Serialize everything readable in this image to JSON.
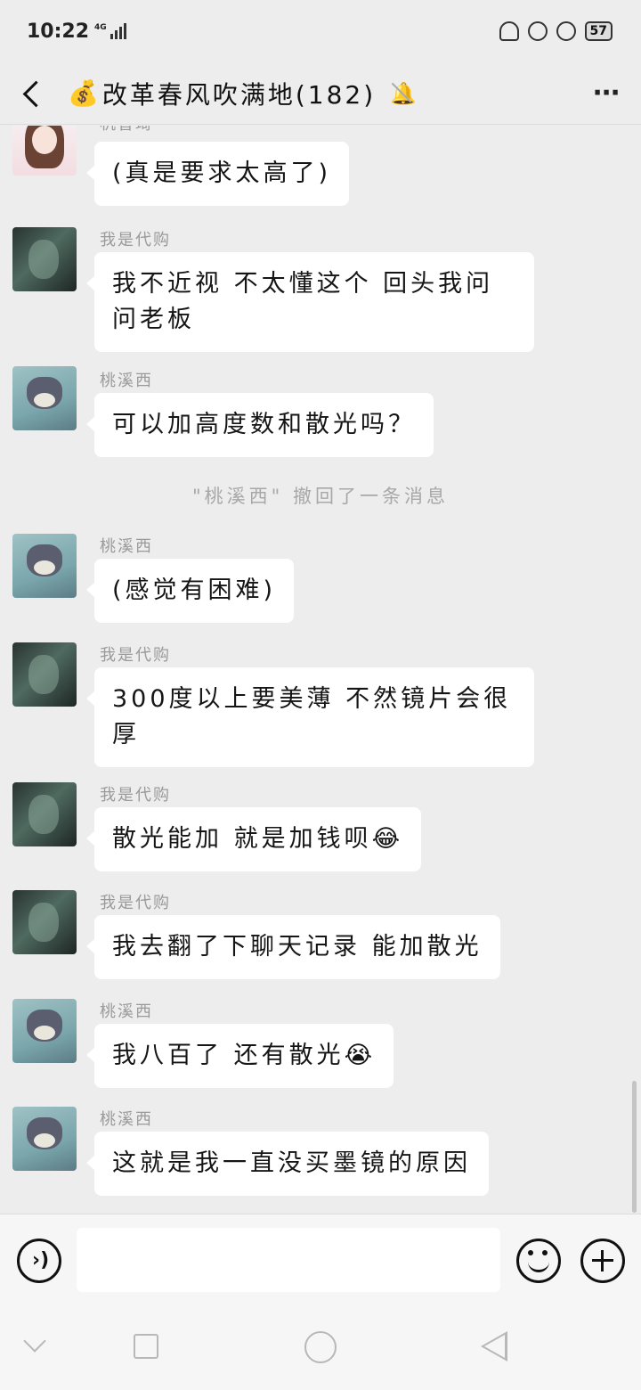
{
  "status_bar": {
    "time": "10:22",
    "network": "4G",
    "battery": "57"
  },
  "title_bar": {
    "emoji": "💰",
    "title": "改革春风吹满地(182)"
  },
  "messages": [
    {
      "sender": "机智琦",
      "text": "(真是要求太高了)",
      "avatar": "girl-avatar"
    },
    {
      "sender": "我是代购",
      "text": "我不近视 不太懂这个 回头我问问老板",
      "avatar": "dark-avatar"
    },
    {
      "sender": "桃溪西",
      "text": "可以加高度数和散光吗？",
      "avatar": "cat-avatar"
    },
    {
      "sender": "桃溪西",
      "text": "(感觉有困难)",
      "avatar": "cat-avatar"
    },
    {
      "sender": "我是代购",
      "text": "300度以上要美薄 不然镜片会很厚",
      "avatar": "dark-avatar"
    },
    {
      "sender": "我是代购",
      "text": "散光能加 就是加钱呗😂",
      "avatar": "dark-avatar"
    },
    {
      "sender": "我是代购",
      "text": "我去翻了下聊天记录 能加散光",
      "avatar": "dark-avatar"
    },
    {
      "sender": "桃溪西",
      "text": "我八百了 还有散光😭",
      "avatar": "cat-avatar"
    },
    {
      "sender": "桃溪西",
      "text": "这就是我一直没买墨镜的原因",
      "avatar": "cat-avatar"
    }
  ],
  "system_notice": "\"桃溪西\" 撤回了一条消息",
  "input_bar": {
    "voice_icon": "voice-icon",
    "emoji_icon": "emoji-icon",
    "plus_icon": "plus-icon",
    "input_value": ""
  }
}
